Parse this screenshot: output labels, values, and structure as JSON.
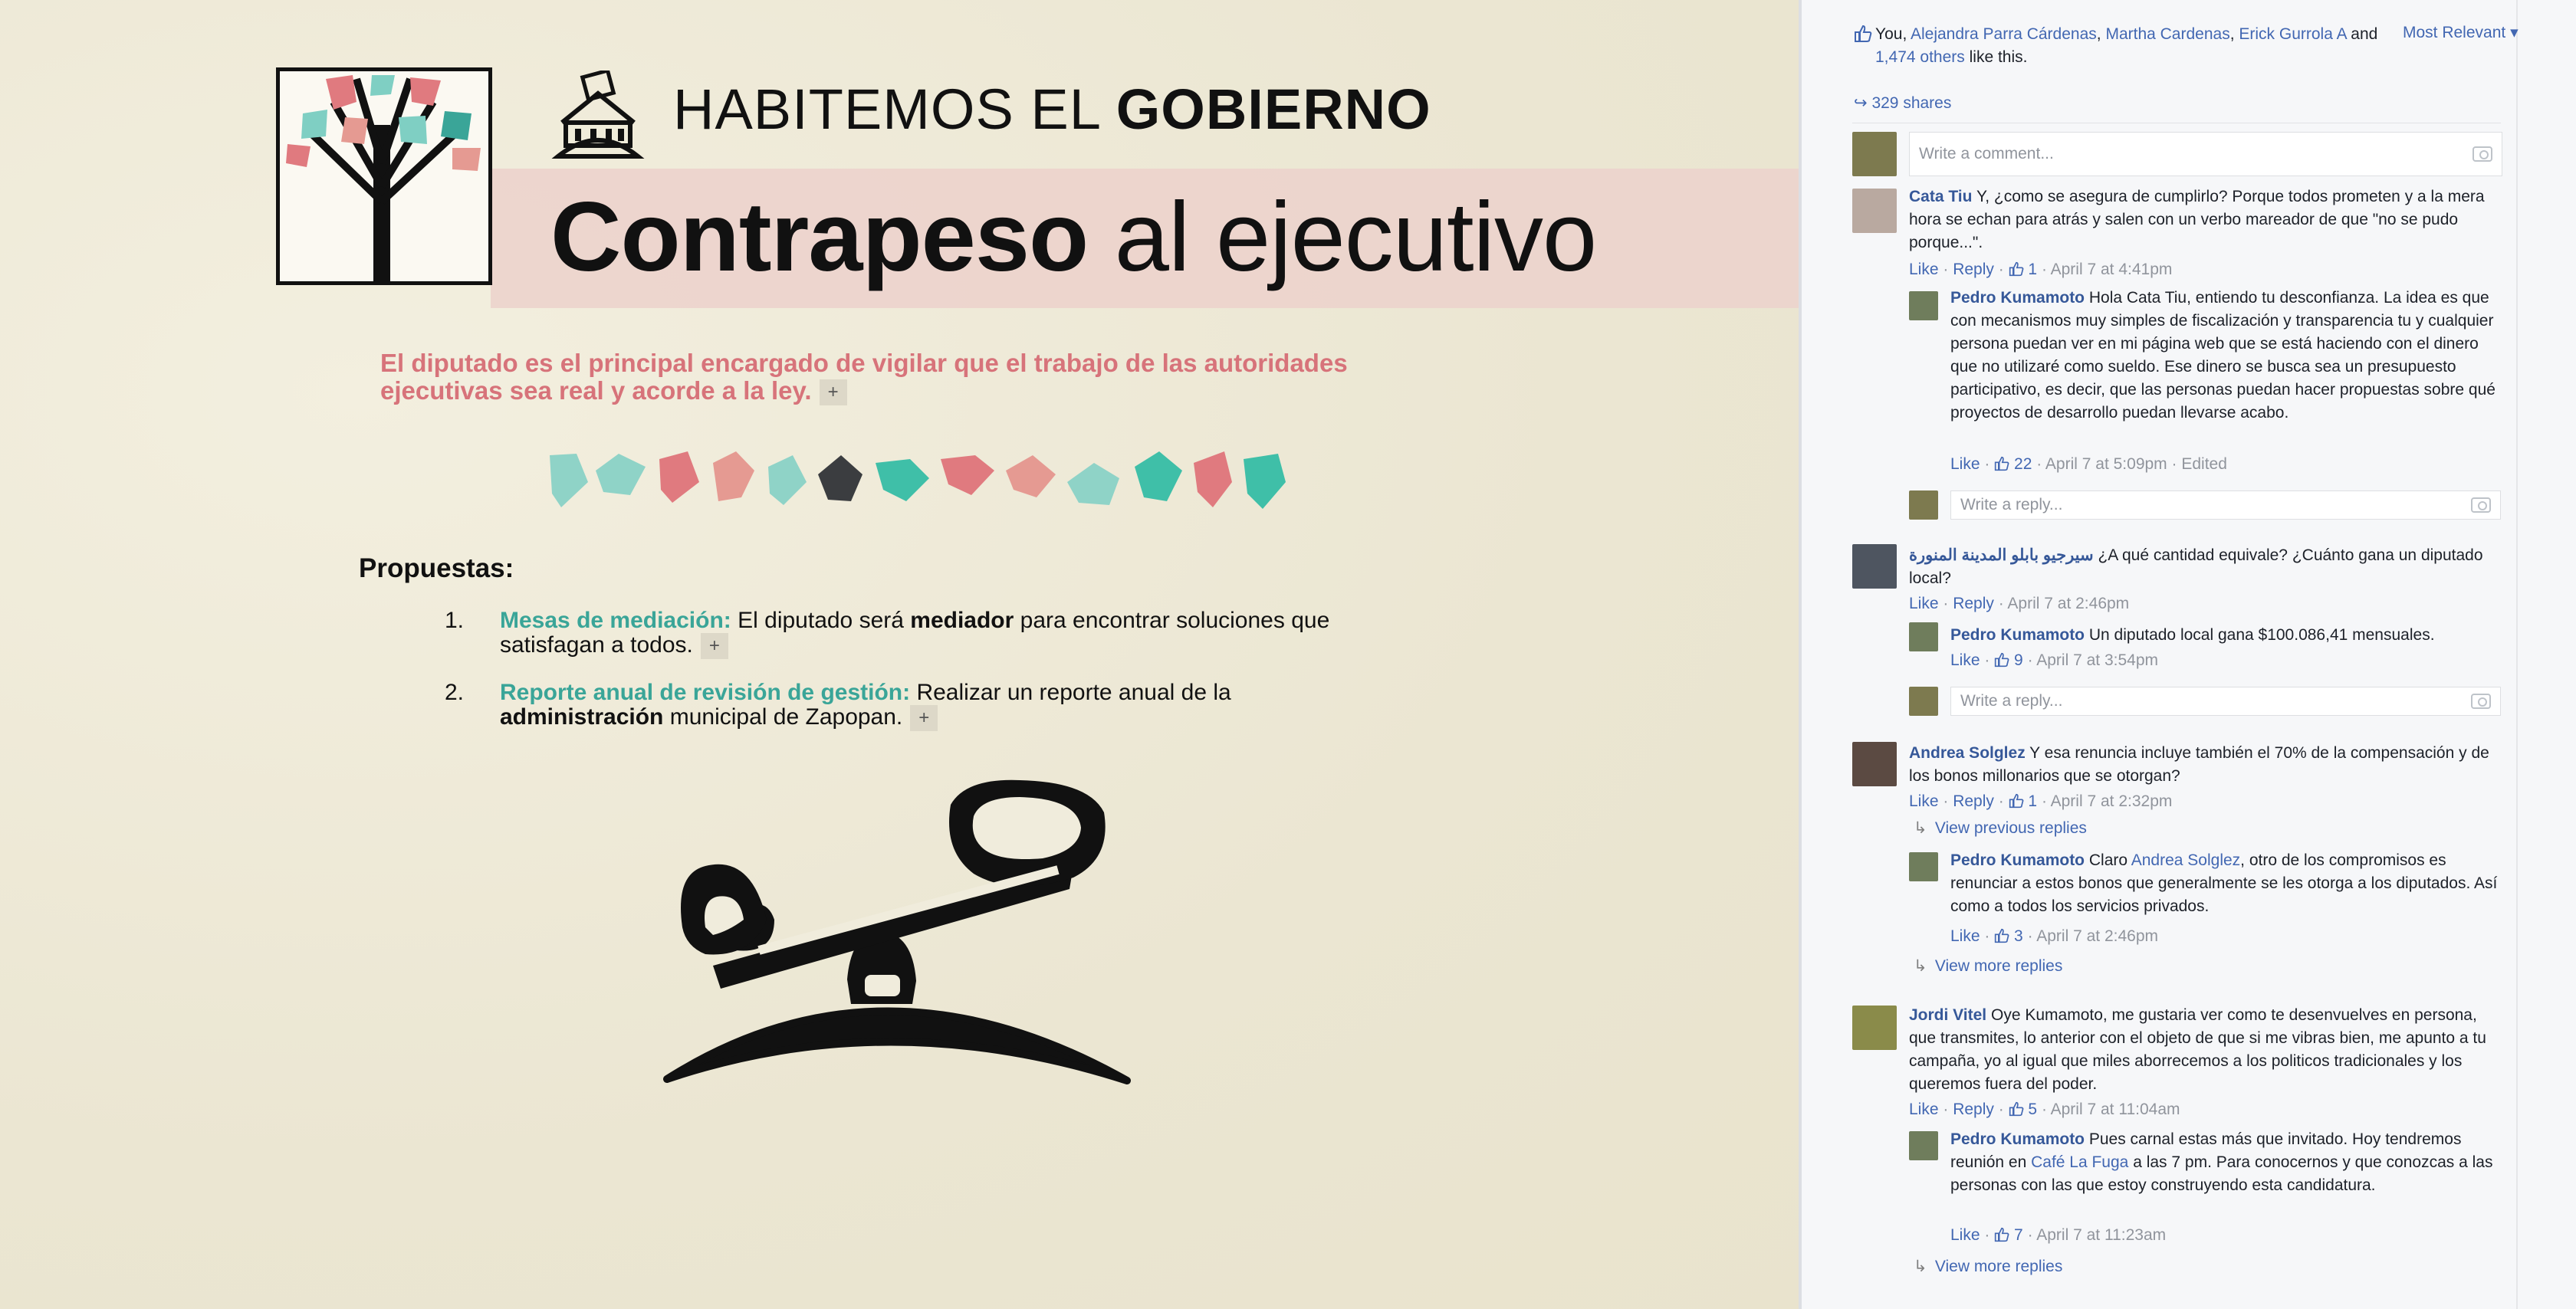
{
  "poster": {
    "title_light": "HABITEMOS EL",
    "title_bold": "GOBIERNO",
    "headline_bold": "Contrapeso",
    "headline_light": "al ejecutivo",
    "intro": "El diputado es el principal encargado de vigilar que el trabajo de las autoridades ejecutivas sea real y acorde a la ley.",
    "plus": "+",
    "propuestas_title": "Propuestas:",
    "items": [
      {
        "num": "1.",
        "highlight": "Mesas de mediación:",
        "pre": "El diputado será",
        "bold": "mediador",
        "post": "para encontrar soluciones que satisfagan a todos."
      },
      {
        "num": "2.",
        "highlight": "Reporte anual de revisión de gestión:",
        "pre": "Realizar un reporte anual de la",
        "bold": "administración",
        "post": "municipal de Zapopan."
      }
    ],
    "colors": {
      "teal": "#3aa598",
      "pink": "#d7737a",
      "band": "#ecd3cc"
    }
  },
  "fb": {
    "likes": {
      "you": "You,",
      "names": [
        "Alejandra Parra Cárdenas",
        "Martha Cardenas",
        "Erick Gurrola A"
      ],
      "and": "and",
      "others": "1,474 others",
      "tail": "like this."
    },
    "sort": "Most Relevant",
    "shares": "329 shares",
    "comment_placeholder": "Write a comment...",
    "reply_placeholder": "Write a reply...",
    "like": "Like",
    "reply": "Reply",
    "view_previous": "View previous replies",
    "view_more": "View more replies",
    "comments": [
      {
        "name": "Cata Tiu",
        "text": "Y, ¿como se asegura de cumplirlo? Porque todos prometen y a la mera hora se echan para atrás y salen con un verbo mareador de que \"no se pudo porque...\".",
        "likes": "1",
        "time": "April 7 at 4:41pm"
      },
      {
        "name": "Pedro Kumamoto",
        "text": "Hola Cata Tiu, entiendo tu desconfianza. La idea es que con mecanismos muy simples de fiscalización y transparencia tu y cualquier persona puedan ver en mi página web que se está haciendo con el dinero que no utilizaré como sueldo. Ese dinero se busca sea un presupuesto participativo, es decir, que las personas puedan hacer propuestas sobre qué proyectos de desarrollo puedan llevarse acabo.",
        "likes": "22",
        "time": "April 7 at 5:09pm",
        "edited": "Edited"
      },
      {
        "name": "سيرجيو بابلو المدينة المنورة",
        "text": "¿A qué cantidad equivale? ¿Cuánto gana un diputado local?",
        "time": "April 7 at 2:46pm"
      },
      {
        "name": "Pedro Kumamoto",
        "text": "Un diputado local gana $100.086,41 mensuales.",
        "likes": "9",
        "time": "April 7 at 3:54pm"
      },
      {
        "name": "Andrea Solglez",
        "text": "Y esa renuncia incluye también el 70% de la compensación y de los bonos millonarios que se otorgan?",
        "likes": "1",
        "time": "April 7 at 2:32pm"
      },
      {
        "name": "Pedro Kumamoto",
        "pre": "Claro",
        "mention": "Andrea Solglez",
        "text": ", otro de los compromisos es renunciar a estos bonos que generalmente se les otorga a los diputados. Así como a todos los servicios privados.",
        "likes": "3",
        "time": "April 7 at 2:46pm"
      },
      {
        "name": "Jordi Vitel",
        "text": "Oye Kumamoto, me gustaria ver como te desenvuelves en persona, que transmites, lo anterior con el objeto de que si me vibras bien, me apunto a tu campaña, yo al igual que miles aborrecemos a los politicos tradicionales y los queremos fuera del poder.",
        "likes": "5",
        "time": "April 7 at 11:04am"
      },
      {
        "name": "Pedro Kumamoto",
        "pre": "Pues carnal estas más que invitado. Hoy tendremos reunión en",
        "mention": "Café La Fuga",
        "text": "a las 7 pm. Para conocernos y que conozcas a las personas con las que estoy construyendo esta candidatura.",
        "likes": "7",
        "time": "April 7 at 11:23am"
      }
    ]
  }
}
